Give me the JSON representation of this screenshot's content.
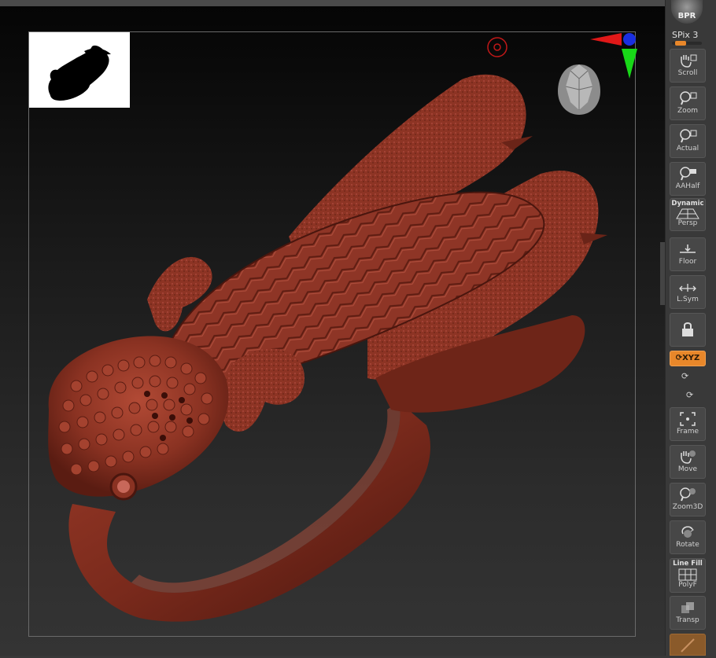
{
  "sidebar": {
    "bpr_label": "BPR",
    "spix_label": "SPix 3",
    "buttons": {
      "scroll": "Scroll",
      "zoom": "Zoom",
      "actual": "Actual",
      "aahalf": "AAHalf",
      "dynamic": "Dynamic",
      "persp": "Persp",
      "floor": "Floor",
      "lsym": "L.Sym",
      "xyz": "XYZ",
      "frame": "Frame",
      "move": "Move",
      "zoom3d": "Zoom3D",
      "rotate": "Rotate",
      "linefill": "Line Fill",
      "polyf": "PolyF",
      "transp": "Transp"
    }
  },
  "colors": {
    "model_red": "#8a3222",
    "accent_orange": "#e8872a",
    "viewport_dark": "#0a0a0a"
  },
  "icons": [
    "navigator-thumbnail",
    "camera-head-icon",
    "axis-gizmo-icon",
    "rotation-center-icon"
  ]
}
